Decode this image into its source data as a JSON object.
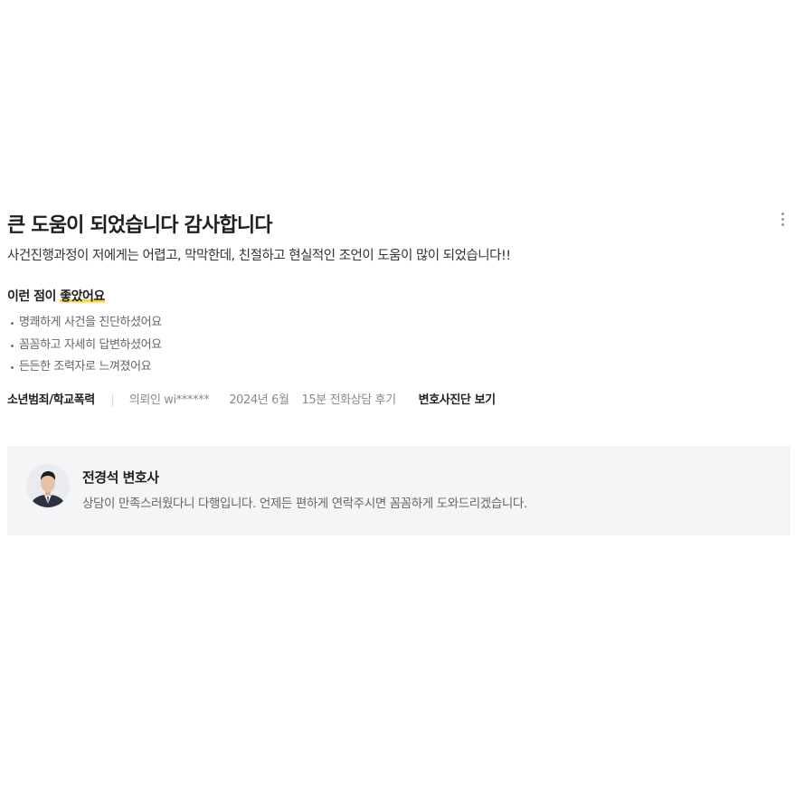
{
  "review": {
    "title": "큰 도움이 되었습니다 감사합니다",
    "body": "사건진행과정이 저에게는 어렵고, 막막한데, 친절하고 현실적인 조언이 도움이 많이 되었습니다!!",
    "likes_heading_prefix": "이런 점이 ",
    "likes_heading_highlight": "좋았어요",
    "likes": [
      "명쾌하게 사건을 진단하셨어요",
      "꼼꼼하고 자세히 답변하셨어요",
      "든든한 조력자로 느껴졌어요"
    ],
    "meta": {
      "category": "소년범죄/학교폭력",
      "client": "의뢰인 wi******",
      "date": "2024년 6월",
      "consult_type": "15분 전화상담 후기",
      "diagnosis_link": "변호사진단 보기"
    },
    "more_icon": "vertical-ellipsis-icon"
  },
  "reply": {
    "lawyer_name": "전경석 변호사",
    "text": "상담이 만족스러웠다니 다행입니다. 언제든 편하게 연락주시면 꼼꼼하게 도와드리겠습니다."
  },
  "colors": {
    "highlight": "#ffd43b",
    "reply_background": "#f4f5f7"
  }
}
